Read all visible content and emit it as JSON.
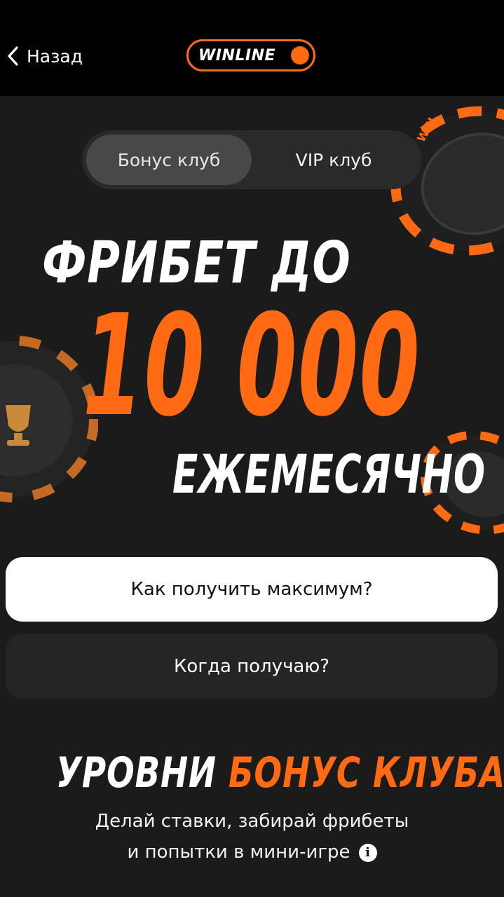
{
  "header": {
    "back_label": "Назад",
    "logo_text": "WINLINE",
    "accent_color": "#ff6a13"
  },
  "tabs": [
    {
      "label": "Бонус клуб",
      "active": true
    },
    {
      "label": "VIP клуб",
      "active": false
    }
  ],
  "hero": {
    "line1": "ФРИБЕТ ДО",
    "amount": "10 000",
    "line3": "ЕЖЕМЕСЯЧНО",
    "chip_text": "WIN"
  },
  "buttons": {
    "max_label": "Как получить максимум?",
    "when_label": "Когда получаю?"
  },
  "levels": {
    "title_white": "УРОВНИ",
    "title_orange": "БОНУС КЛУБА",
    "subtitle_line1": "Делай ставки, забирай фрибеты",
    "subtitle_line2": "и попытки в мини-игре",
    "info_icon": "info-icon"
  }
}
